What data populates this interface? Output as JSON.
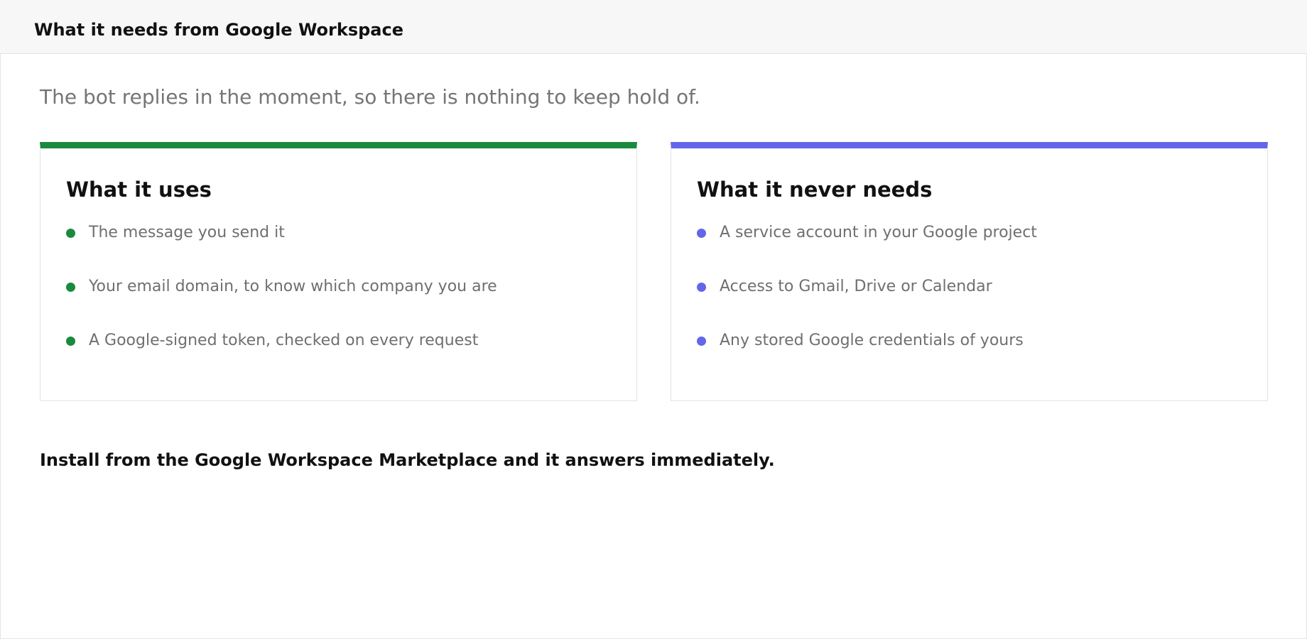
{
  "header": {
    "title": "What it needs from Google Workspace"
  },
  "intro": "The bot replies in the moment, so there is nothing to keep hold of.",
  "cards": [
    {
      "title": "What it uses",
      "accent": "#1a8a3e",
      "items": [
        "The message you send it",
        "Your email domain, to know which company you are",
        "A Google-signed token, checked on every request"
      ]
    },
    {
      "title": "What it never needs",
      "accent": "#6366e8",
      "items": [
        "A service account in your Google project",
        "Access to Gmail, Drive or Calendar",
        "Any stored Google credentials of yours"
      ]
    }
  ],
  "footer": "Install from the Google Workspace Marketplace and it answers immediately."
}
